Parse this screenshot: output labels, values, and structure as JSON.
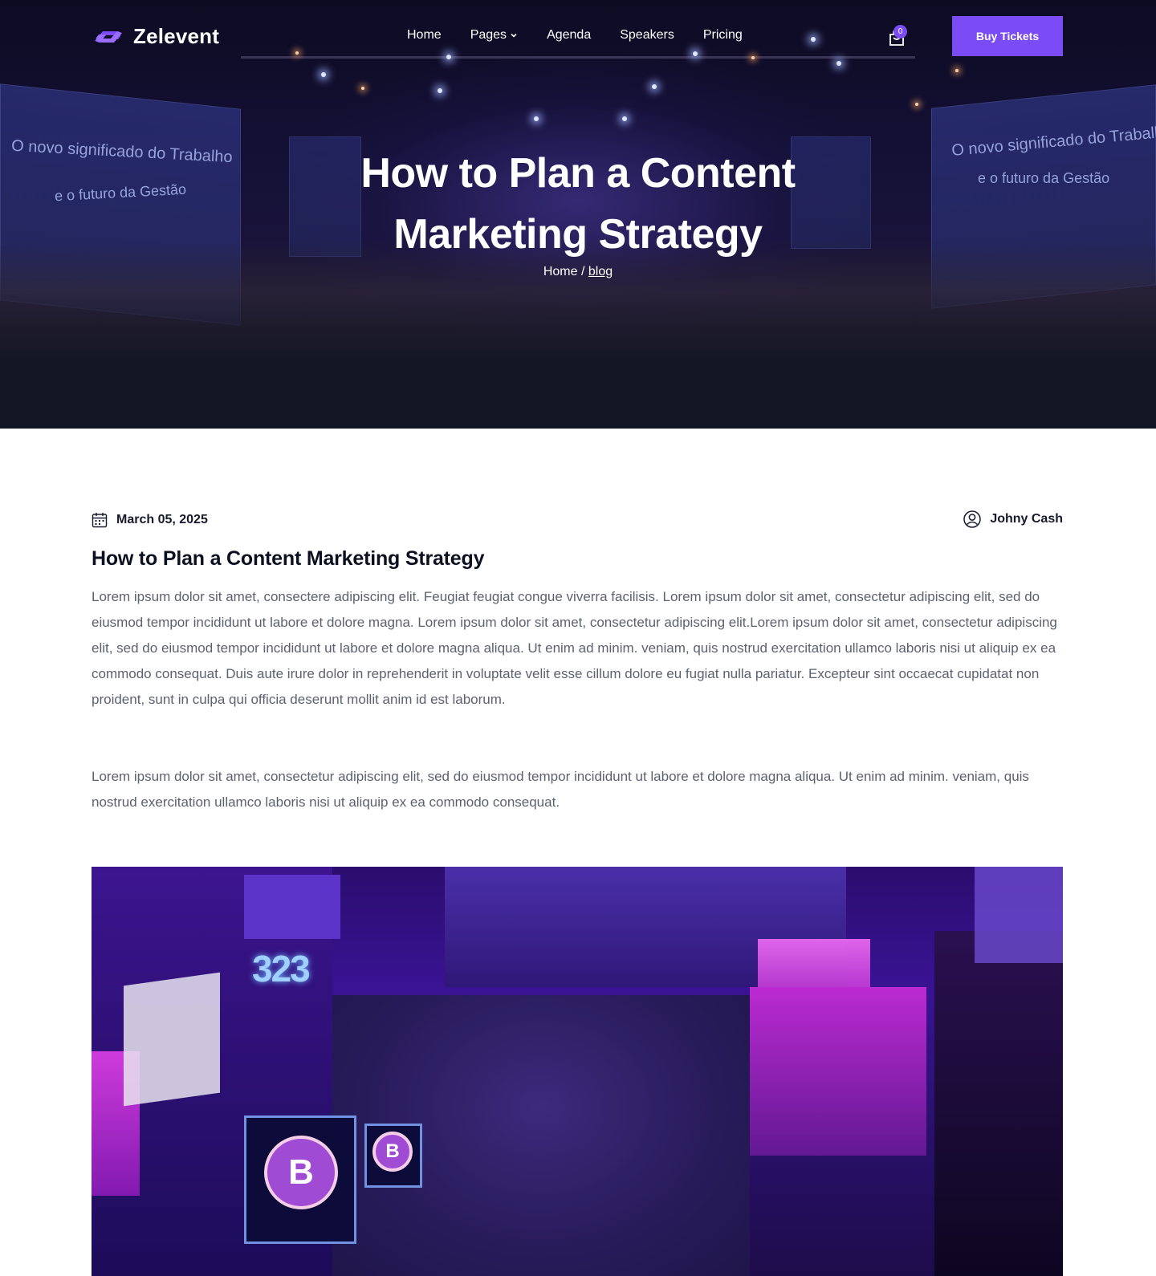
{
  "brand": {
    "name": "Zelevent",
    "accent_color": "#7b4cf5"
  },
  "nav": {
    "items": [
      {
        "label": "Home",
        "has_dropdown": false
      },
      {
        "label": "Pages",
        "has_dropdown": true
      },
      {
        "label": "Agenda",
        "has_dropdown": false
      },
      {
        "label": "Speakers",
        "has_dropdown": false
      },
      {
        "label": "Pricing",
        "has_dropdown": false
      }
    ],
    "cart_count": "0",
    "cta_label": "Buy Tickets"
  },
  "hero": {
    "title_line1": "How to Plan a Content",
    "title_line2": "Marketing Strategy",
    "breadcrumb": {
      "home": "Home",
      "separator": "/",
      "current": "blog"
    },
    "screen_text_line1": "O novo significado do Trabalho",
    "screen_text_line2": "e o futuro da Gestão"
  },
  "article": {
    "date": "March 05, 2025",
    "author": "Johny Cash",
    "title": "How to Plan a Content Marketing Strategy",
    "paragraph1": "Lorem ipsum dolor sit amet, consectere adipiscing elit. Feugiat feugiat congue viverra facilisis. Lorem ipsum dolor sit amet, consectetur adipiscing elit, sed do eiusmod tempor incididunt ut labore et dolore magna. Lorem ipsum dolor sit amet, consectetur adipiscing elit.Lorem ipsum dolor sit amet, consectetur adipiscing elit, sed do eiusmod tempor incididunt ut labore et dolore magna aliqua. Ut enim ad minim. veniam, quis nostrud exercitation ullamco laboris nisi ut aliquip ex ea commodo consequat. Duis aute irure dolor in reprehenderit in voluptate velit esse cillum dolore eu fugiat nulla pariatur. Excepteur sint occaecat cupidatat non proident, sunt in culpa qui officia deserunt mollit anim id est laborum.",
    "paragraph2": "Lorem ipsum dolor sit amet, consectetur adipiscing elit, sed do eiusmod tempor incididunt ut labore et dolore magna aliqua. Ut enim ad minim. veniam, quis nostrud exercitation ullamco laboris nisi ut aliquip ex ea commodo consequat."
  },
  "icons": {
    "calendar": "calendar-icon",
    "user": "user-circle-icon",
    "cart": "shopping-bag-icon",
    "chevron": "chevron-down-icon"
  }
}
